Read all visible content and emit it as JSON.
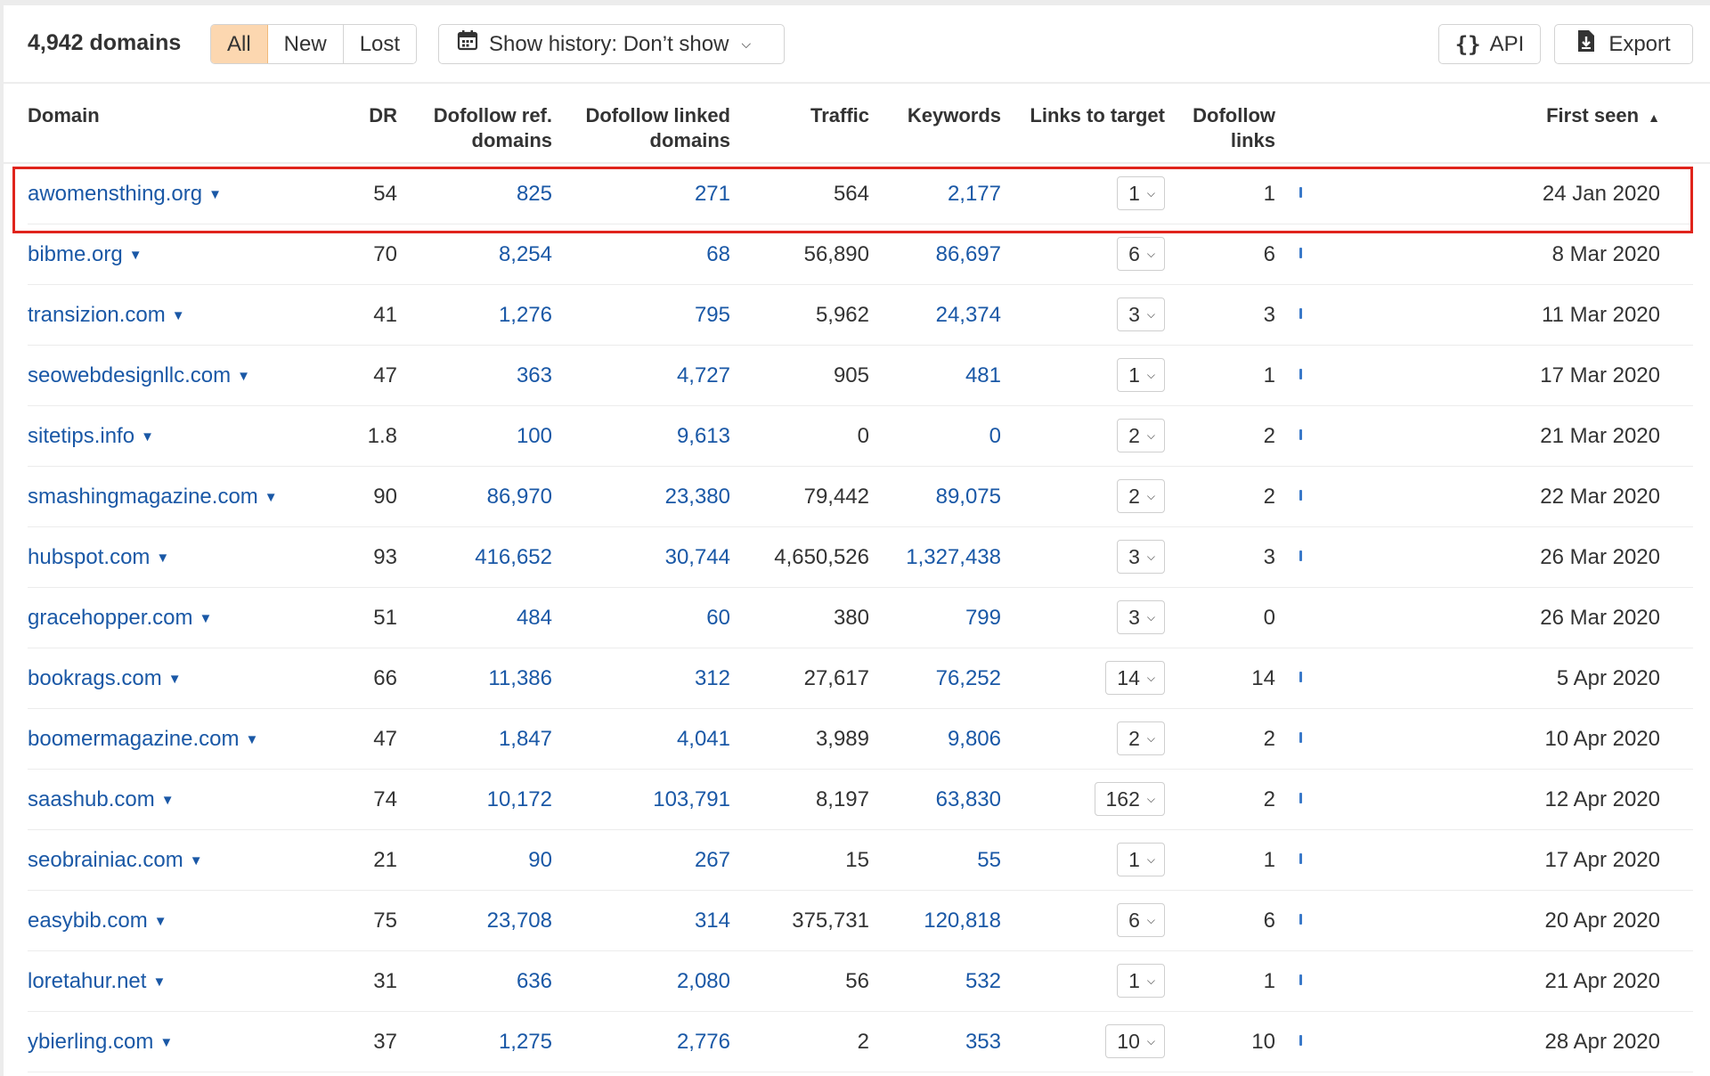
{
  "toolbar": {
    "count": "4,942 domains",
    "filters": [
      "All",
      "New",
      "Lost"
    ],
    "active_filter": "All",
    "history_label": "Show history: Don’t show",
    "api_label": "API",
    "export_label": "Export"
  },
  "colors": {
    "link": "#1a58a6",
    "active_filter_bg": "#fcd7b0",
    "highlight": "#e0241c",
    "bar": "#3a79c9"
  },
  "columns": {
    "domain": "Domain",
    "dr": "DR",
    "dofollow_ref_1": "Dofollow ref.",
    "dofollow_ref_2": "domains",
    "dofollow_linked_1": "Dofollow linked",
    "dofollow_linked_2": "domains",
    "traffic": "Traffic",
    "keywords": "Keywords",
    "links_to_target": "Links to target",
    "dofollow_links_1": "Dofollow",
    "dofollow_links_2": "links",
    "first_seen": "First seen",
    "first_seen_sort": "▲"
  },
  "rows": [
    {
      "domain": "awomensthing.org",
      "dr": "54",
      "ref": "825",
      "linked": "271",
      "traffic": "564",
      "keywords": "2,177",
      "ltt": "1",
      "dofollow": "1",
      "bar": true,
      "first_seen": "24 Jan 2020"
    },
    {
      "domain": "bibme.org",
      "dr": "70",
      "ref": "8,254",
      "linked": "68",
      "traffic": "56,890",
      "keywords": "86,697",
      "ltt": "6",
      "dofollow": "6",
      "bar": true,
      "first_seen": "8 Mar 2020"
    },
    {
      "domain": "transizion.com",
      "dr": "41",
      "ref": "1,276",
      "linked": "795",
      "traffic": "5,962",
      "keywords": "24,374",
      "ltt": "3",
      "dofollow": "3",
      "bar": true,
      "first_seen": "11 Mar 2020"
    },
    {
      "domain": "seowebdesignllc.com",
      "dr": "47",
      "ref": "363",
      "linked": "4,727",
      "traffic": "905",
      "keywords": "481",
      "ltt": "1",
      "dofollow": "1",
      "bar": true,
      "first_seen": "17 Mar 2020"
    },
    {
      "domain": "sitetips.info",
      "dr": "1.8",
      "ref": "100",
      "linked": "9,613",
      "traffic": "0",
      "keywords": "0",
      "ltt": "2",
      "dofollow": "2",
      "bar": true,
      "first_seen": "21 Mar 2020"
    },
    {
      "domain": "smashingmagazine.com",
      "dr": "90",
      "ref": "86,970",
      "linked": "23,380",
      "traffic": "79,442",
      "keywords": "89,075",
      "ltt": "2",
      "dofollow": "2",
      "bar": true,
      "first_seen": "22 Mar 2020"
    },
    {
      "domain": "hubspot.com",
      "dr": "93",
      "ref": "416,652",
      "linked": "30,744",
      "traffic": "4,650,526",
      "keywords": "1,327,438",
      "ltt": "3",
      "dofollow": "3",
      "bar": true,
      "first_seen": "26 Mar 2020"
    },
    {
      "domain": "gracehopper.com",
      "dr": "51",
      "ref": "484",
      "linked": "60",
      "traffic": "380",
      "keywords": "799",
      "ltt": "3",
      "dofollow": "0",
      "bar": false,
      "first_seen": "26 Mar 2020"
    },
    {
      "domain": "bookrags.com",
      "dr": "66",
      "ref": "11,386",
      "linked": "312",
      "traffic": "27,617",
      "keywords": "76,252",
      "ltt": "14",
      "dofollow": "14",
      "bar": true,
      "first_seen": "5 Apr 2020"
    },
    {
      "domain": "boomermagazine.com",
      "dr": "47",
      "ref": "1,847",
      "linked": "4,041",
      "traffic": "3,989",
      "keywords": "9,806",
      "ltt": "2",
      "dofollow": "2",
      "bar": true,
      "first_seen": "10 Apr 2020"
    },
    {
      "domain": "saashub.com",
      "dr": "74",
      "ref": "10,172",
      "linked": "103,791",
      "traffic": "8,197",
      "keywords": "63,830",
      "ltt": "162",
      "dofollow": "2",
      "bar": true,
      "first_seen": "12 Apr 2020"
    },
    {
      "domain": "seobrainiac.com",
      "dr": "21",
      "ref": "90",
      "linked": "267",
      "traffic": "15",
      "keywords": "55",
      "ltt": "1",
      "dofollow": "1",
      "bar": true,
      "first_seen": "17 Apr 2020"
    },
    {
      "domain": "easybib.com",
      "dr": "75",
      "ref": "23,708",
      "linked": "314",
      "traffic": "375,731",
      "keywords": "120,818",
      "ltt": "6",
      "dofollow": "6",
      "bar": true,
      "first_seen": "20 Apr 2020"
    },
    {
      "domain": "loretahur.net",
      "dr": "31",
      "ref": "636",
      "linked": "2,080",
      "traffic": "56",
      "keywords": "532",
      "ltt": "1",
      "dofollow": "1",
      "bar": true,
      "first_seen": "21 Apr 2020"
    },
    {
      "domain": "ybierling.com",
      "dr": "37",
      "ref": "1,275",
      "linked": "2,776",
      "traffic": "2",
      "keywords": "353",
      "ltt": "10",
      "dofollow": "10",
      "bar": true,
      "first_seen": "28 Apr 2020"
    }
  ]
}
